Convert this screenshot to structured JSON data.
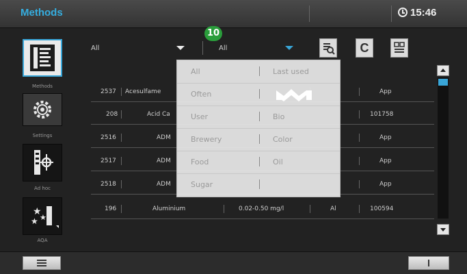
{
  "app": {
    "title": "Methods",
    "time": "15:46"
  },
  "sidebar": {
    "items": [
      {
        "label": "Methods",
        "icon": "methods-list-icon"
      },
      {
        "label": "Settings",
        "icon": "settings-gear-icon"
      },
      {
        "label": "Ad hoc",
        "icon": "ad-hoc-icon"
      },
      {
        "label": "AQA",
        "icon": "aqa-stars-icon"
      }
    ]
  },
  "filters": {
    "primary": "All",
    "secondary": "All"
  },
  "step_badge": "10",
  "toolbar": {
    "c_label": "C"
  },
  "table": {
    "rows": [
      {
        "id": "2537",
        "name": "Acesulfame",
        "range": "",
        "param": "",
        "code": "App"
      },
      {
        "id": "208",
        "name": "Acid Ca",
        "range": "",
        "param": "",
        "code": "101758"
      },
      {
        "id": "2516",
        "name": "ADM",
        "range": "",
        "param": "",
        "code": "App"
      },
      {
        "id": "2517",
        "name": "ADM",
        "range": "",
        "param": "",
        "code": "App"
      },
      {
        "id": "2518",
        "name": "ADM",
        "range": "",
        "param": "",
        "code": "App"
      },
      {
        "id": "196",
        "name": "Aluminium",
        "range": "0.02-0.50 mg/l",
        "param": "Al",
        "code": "100594"
      }
    ]
  },
  "dropdown": {
    "options": [
      [
        "All",
        "Last used"
      ],
      [
        "Often",
        "merck-logo"
      ],
      [
        "User",
        "Bio"
      ],
      [
        "Brewery",
        "Color"
      ],
      [
        "Food",
        "Oil"
      ],
      [
        "Sugar",
        ""
      ]
    ]
  },
  "colors": {
    "accent": "#39a6d8",
    "badge": "#2a9d3b",
    "logo": "#ffffff"
  }
}
